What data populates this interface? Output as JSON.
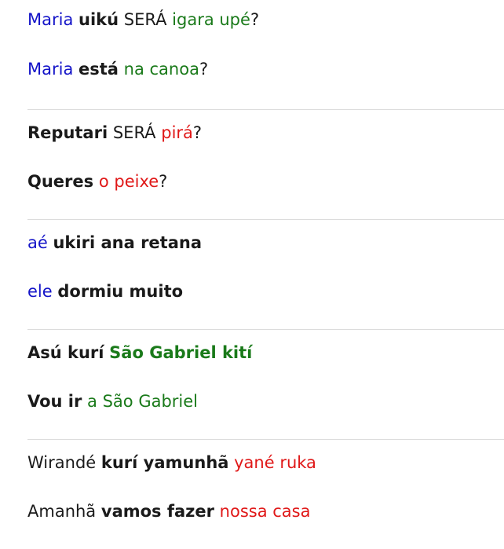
{
  "colors": {
    "blue": "#1414c8",
    "green": "#1a7a1a",
    "red": "#e01818",
    "default": "#1a1a1a"
  },
  "examples": [
    {
      "source": [
        {
          "text": "Maria",
          "color": "blue",
          "bold": false
        },
        {
          "text": " ",
          "color": "default",
          "bold": false
        },
        {
          "text": "uikú",
          "color": "default",
          "bold": true
        },
        {
          "text": " SERÁ ",
          "color": "default",
          "bold": false
        },
        {
          "text": "igara upé",
          "color": "green",
          "bold": false
        },
        {
          "text": "?",
          "color": "default",
          "bold": false
        }
      ],
      "translation": [
        {
          "text": "Maria",
          "color": "blue",
          "bold": false
        },
        {
          "text": " ",
          "color": "default",
          "bold": false
        },
        {
          "text": "está",
          "color": "default",
          "bold": true
        },
        {
          "text": " ",
          "color": "default",
          "bold": false
        },
        {
          "text": "na canoa",
          "color": "green",
          "bold": false
        },
        {
          "text": "?",
          "color": "default",
          "bold": false
        }
      ]
    },
    {
      "source": [
        {
          "text": "Reputari",
          "color": "default",
          "bold": true
        },
        {
          "text": " SERÁ ",
          "color": "default",
          "bold": false
        },
        {
          "text": "pirá",
          "color": "red",
          "bold": false
        },
        {
          "text": "?",
          "color": "default",
          "bold": false
        }
      ],
      "translation": [
        {
          "text": "Queres",
          "color": "default",
          "bold": true
        },
        {
          "text": " ",
          "color": "default",
          "bold": false
        },
        {
          "text": "o peixe",
          "color": "red",
          "bold": false
        },
        {
          "text": "?",
          "color": "default",
          "bold": false
        }
      ]
    },
    {
      "source": [
        {
          "text": "aé",
          "color": "blue",
          "bold": false
        },
        {
          "text": " ",
          "color": "default",
          "bold": false
        },
        {
          "text": "ukiri ana retana",
          "color": "default",
          "bold": true
        }
      ],
      "translation": [
        {
          "text": "ele",
          "color": "blue",
          "bold": false
        },
        {
          "text": " ",
          "color": "default",
          "bold": false
        },
        {
          "text": "dormiu muito",
          "color": "default",
          "bold": true
        }
      ]
    },
    {
      "source": [
        {
          "text": "Asú kurí",
          "color": "default",
          "bold": true
        },
        {
          "text": " ",
          "color": "default",
          "bold": false
        },
        {
          "text": "São Gabriel kití",
          "color": "green",
          "bold": true
        }
      ],
      "translation": [
        {
          "text": "Vou ir",
          "color": "default",
          "bold": true
        },
        {
          "text": " ",
          "color": "default",
          "bold": false
        },
        {
          "text": "a São Gabriel",
          "color": "green",
          "bold": false
        }
      ]
    },
    {
      "source": [
        {
          "text": "Wirandé",
          "color": "default",
          "bold": false
        },
        {
          "text": " ",
          "color": "default",
          "bold": false
        },
        {
          "text": "kurí yamunhã",
          "color": "default",
          "bold": true
        },
        {
          "text": " ",
          "color": "default",
          "bold": false
        },
        {
          "text": "yané ruka",
          "color": "red",
          "bold": false
        }
      ],
      "translation": [
        {
          "text": "Amanhã",
          "color": "default",
          "bold": false
        },
        {
          "text": " ",
          "color": "default",
          "bold": false
        },
        {
          "text": "vamos fazer",
          "color": "default",
          "bold": true
        },
        {
          "text": " ",
          "color": "default",
          "bold": false
        },
        {
          "text": "nossa casa",
          "color": "red",
          "bold": false
        }
      ]
    }
  ]
}
